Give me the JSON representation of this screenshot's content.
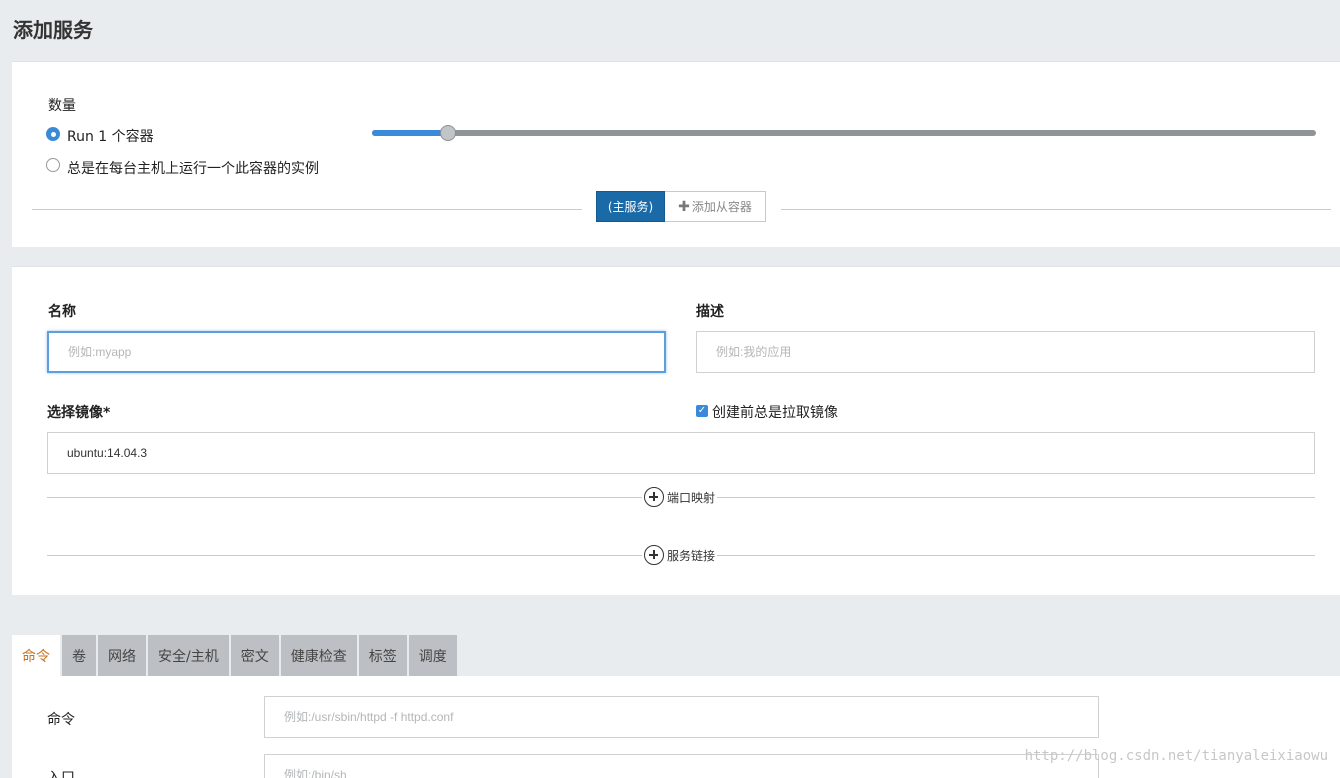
{
  "page": {
    "title": "添加服务"
  },
  "scale": {
    "label": "数量",
    "option_run": "Run 1 个容器",
    "option_global": "总是在每台主机上运行一个此容器的实例",
    "selected": "run",
    "slider_value_fraction": 0.08,
    "primary_service_button": "(主服务)",
    "add_sidekick_button": "添加从容器"
  },
  "form": {
    "name_label": "名称",
    "name_placeholder": "例如:myapp",
    "description_label": "描述",
    "description_placeholder": "例如:我的应用",
    "image_label": "选择镜像*",
    "image_value": "ubuntu:14.04.3",
    "always_pull_label": "创建前总是拉取镜像",
    "always_pull_checked": true,
    "port_mapping": "端口映射",
    "service_links": "服务链接"
  },
  "tabs": [
    {
      "label": "命令",
      "active": true
    },
    {
      "label": "卷",
      "active": false
    },
    {
      "label": "网络",
      "active": false
    },
    {
      "label": "安全/主机",
      "active": false
    },
    {
      "label": "密文",
      "active": false
    },
    {
      "label": "健康检查",
      "active": false
    },
    {
      "label": "标签",
      "active": false
    },
    {
      "label": "调度",
      "active": false
    }
  ],
  "command": {
    "command_label": "命令",
    "command_placeholder": "例如:/usr/sbin/httpd -f httpd.conf",
    "entry_label": "入口",
    "entry_placeholder": "例如:/bin/sh"
  },
  "watermark": "http://blog.csdn.net/tianyaleixiaowu",
  "colors": {
    "accent": "#3b8ad9",
    "primary_button": "#1a6aa8",
    "active_tab_text": "#c9701f"
  }
}
